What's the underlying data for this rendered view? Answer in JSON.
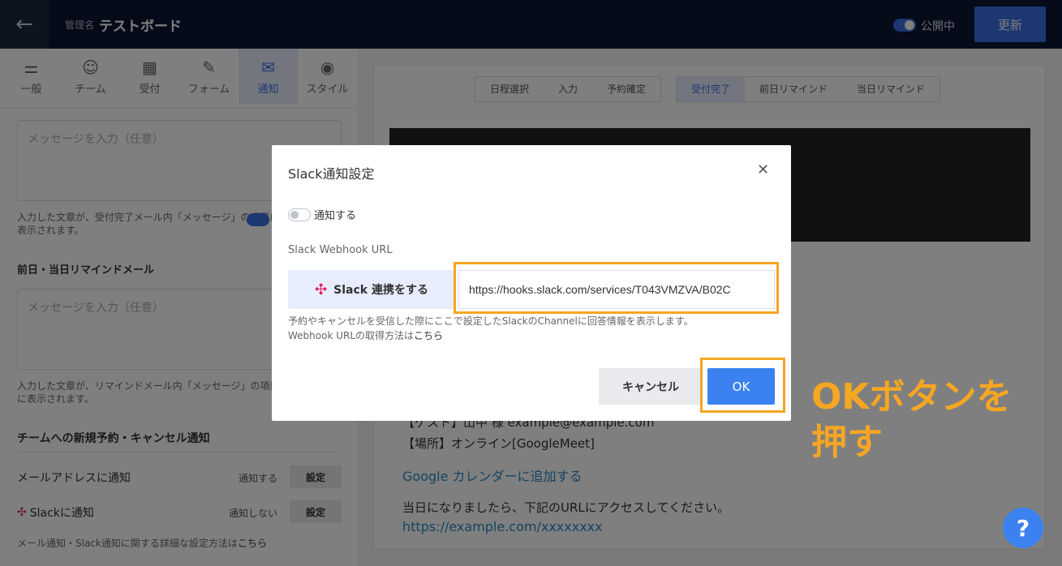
{
  "topbar": {
    "back_icon": "arrow-left-icon",
    "admin_label": "管理名",
    "board_title": "テストボード",
    "publish_label": "公開中",
    "update_label": "更新"
  },
  "settings_tabs": [
    {
      "label": "一般",
      "icon": "sliders-icon"
    },
    {
      "label": "チーム",
      "icon": "team-icon"
    },
    {
      "label": "受付",
      "icon": "calendar-icon"
    },
    {
      "label": "フォーム",
      "icon": "form-icon"
    },
    {
      "label": "通知",
      "icon": "mail-icon"
    },
    {
      "label": "スタイル",
      "icon": "palette-icon"
    }
  ],
  "left": {
    "msg_placeholder_1": "メッセージを入力（任意）",
    "note_1": "入力した文章が、受付完了メール内「メッセージ」の項目に表示されます。",
    "remind_label": "前日・当日リマインドメール",
    "msg_placeholder_2": "メッセージを入力（任意）",
    "note_2": "入力した文章が、リマインドメール内「メッセージ」の項目に表示されます。",
    "section_title": "チームへの新規予約・キャンセル通知",
    "mail_row": {
      "label": "メールアドレスに通知",
      "state": "通知する",
      "button": "設定"
    },
    "slack_row": {
      "label": "Slackに通知",
      "state": "通知しない",
      "button": "設定"
    },
    "foot_note": "メール通知・Slack通知に関する詳細な設定方法は",
    "foot_link": "こちら"
  },
  "preview": {
    "tabs_group_1": [
      "日程選択",
      "入力",
      "予約確定"
    ],
    "tabs_group_2": [
      "受付完了",
      "前日リマインド",
      "当日リマインド"
    ],
    "active_tab": "受付完了",
    "line_guest": "【ゲスト】山中 様 example@example.com",
    "line_place": "【場所】オンライン[GoogleMeet]",
    "calendar_link": "Google カレンダーに追加する",
    "line_access": "当日になりましたら、下記のURLにアクセスしてください。",
    "url_link": "https://example.com/xxxxxxxx"
  },
  "modal": {
    "title": "Slack通知設定",
    "close_icon": "close-icon",
    "notify_label": "通知する",
    "webhook_label": "Slack Webhook URL",
    "slack_button": "Slack 連携をする",
    "url_value": "https://hooks.slack.com/services/T043VMZVA/B02C",
    "help_line_1": "予約やキャンセルを受信した際にここで設定したSlackのChannelに回答情報を表示します。",
    "help_line_2": "Webhook URLの取得方法は",
    "help_link": "こちら",
    "cancel": "キャンセル",
    "ok": "OK"
  },
  "callout": {
    "text_1": "OKボタンを",
    "text_2": "押す",
    "color": "#f5a623"
  },
  "help_button": "?"
}
